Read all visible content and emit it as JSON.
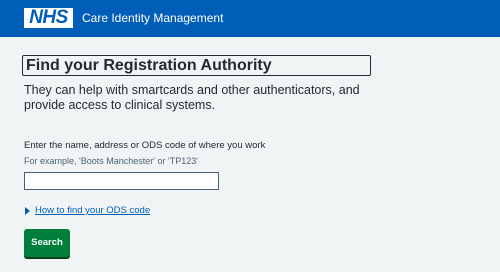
{
  "header": {
    "logo_text": "NHS",
    "service_name": "Care Identity Management",
    "brand_color": "#005eb8"
  },
  "main": {
    "title": "Find your Registration Authority",
    "lede": "They can help with smartcards and other authenticators, and provide access to clinical systems.",
    "field_label": "Enter the name, address or ODS code of where you work",
    "field_hint": "For example, 'Boots Manchester' or 'TP123'",
    "field_value": "",
    "details_summary": "How to find your ODS code",
    "details_icon": "triangle-right-icon",
    "search_button_label": "Search",
    "button_color": "#007f3b"
  }
}
